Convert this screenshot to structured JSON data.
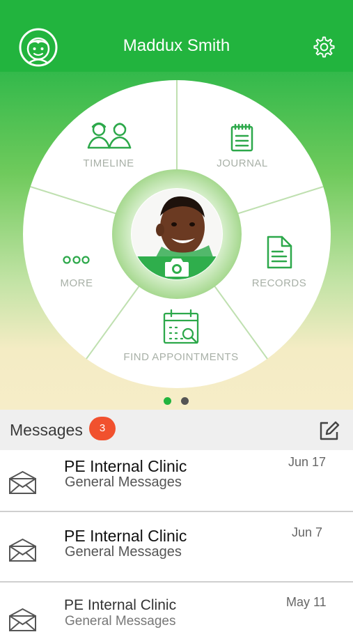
{
  "header": {
    "title": "Maddux Smith"
  },
  "wheel": {
    "segments": {
      "timeline": "TIMELINE",
      "journal": "JOURNAL",
      "more": "MORE",
      "records": "RECORDS",
      "find_appointments": "FIND APPOINTMENTS"
    }
  },
  "pager": {
    "count": 2,
    "active_index": 0
  },
  "messages": {
    "title": "Messages",
    "unread_count": "3",
    "items": [
      {
        "sender": "PE Internal Clinic",
        "category": "General Messages",
        "date": "Jun 17"
      },
      {
        "sender": "PE Internal Clinic",
        "category": "General Messages",
        "date": "Jun 7"
      },
      {
        "sender": "PE Internal Clinic",
        "category": "General Messages",
        "date": "May 11"
      }
    ]
  },
  "colors": {
    "brand_green": "#22b43e",
    "badge_red": "#f1512e"
  },
  "icons": {
    "header_left": "child-avatar-icon",
    "header_right": "gear-icon",
    "compose": "compose-icon",
    "message": "envelope-icon",
    "photo": "camera-icon"
  }
}
